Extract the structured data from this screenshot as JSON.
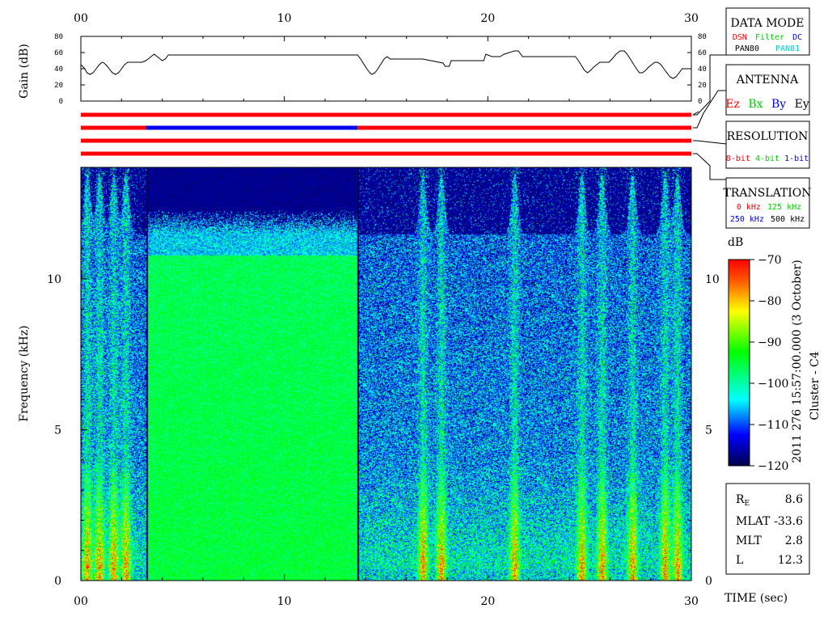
{
  "chart_data": [
    {
      "type": "line",
      "name": "gain",
      "ylabel": "Gain (dB)",
      "xlim": [
        0,
        30
      ],
      "ylim": [
        0,
        80
      ],
      "x_ticks": [
        "00",
        "10",
        "20",
        "30"
      ],
      "y_ticks": [
        "0",
        "20",
        "40",
        "60",
        "80"
      ],
      "series": [
        {
          "x": [
            0,
            0.2,
            0.3,
            0.45,
            0.6,
            0.75,
            0.9,
            1.05,
            1.15,
            1.3,
            1.45,
            1.55,
            1.7,
            1.85,
            2.0,
            2.15,
            2.3,
            2.45,
            2.55,
            2.7,
            3.0,
            3.2,
            3.3,
            3.45,
            3.6,
            3.75,
            3.9,
            4.0,
            4.15,
            4.3,
            13.6,
            13.75,
            13.9,
            14.05,
            14.2,
            14.3,
            14.45,
            14.6,
            14.75,
            14.9,
            15.05,
            15.2,
            16.8,
            17.8,
            17.9,
            18.1,
            18.2,
            19.8,
            19.9,
            20.2,
            20.6,
            20.8,
            21.3,
            21.5,
            21.7,
            24.3,
            24.45,
            24.6,
            24.75,
            24.9,
            25.05,
            25.2,
            25.35,
            25.5,
            25.65,
            25.8,
            25.95,
            26.1,
            26.3,
            26.5,
            26.7,
            26.85,
            27.0,
            27.15,
            27.3,
            27.45,
            27.6,
            27.75,
            27.9,
            28.05,
            28.2,
            28.35,
            28.5,
            28.65,
            28.8,
            28.95,
            29.1,
            29.25,
            29.4,
            29.55,
            29.7,
            29.85,
            30.0
          ],
          "y": [
            45,
            40,
            35,
            33,
            35,
            40,
            45,
            48,
            47,
            43,
            38,
            35,
            33,
            35,
            40,
            45,
            48,
            48,
            48,
            48,
            48,
            50,
            52,
            55,
            58,
            55,
            52,
            50,
            52,
            57,
            57,
            52,
            46,
            40,
            35,
            33,
            35,
            40,
            46,
            52,
            55,
            52,
            52,
            47,
            43,
            43,
            50,
            50,
            58,
            55,
            55,
            58,
            62,
            62,
            55,
            55,
            50,
            44,
            38,
            35,
            38,
            42,
            45,
            48,
            48,
            48,
            48,
            52,
            58,
            62,
            62,
            58,
            52,
            46,
            40,
            35,
            35,
            38,
            42,
            45,
            48,
            48,
            45,
            40,
            35,
            30,
            28,
            30,
            35,
            40,
            40,
            40,
            40
          ]
        }
      ]
    },
    {
      "type": "table",
      "name": "mode-bars",
      "rows": [
        {
          "segments": [
            [
              0,
              30,
              "#ff0000"
            ]
          ]
        },
        {
          "segments": [
            [
              0,
              3.2,
              "#ff0000"
            ],
            [
              3.2,
              13.6,
              "#0000ee"
            ],
            [
              13.6,
              30,
              "#ff0000"
            ]
          ]
        },
        {
          "segments": [
            [
              0,
              30,
              "#ff0000"
            ]
          ]
        },
        {
          "segments": [
            [
              0,
              30,
              "#ff0000"
            ]
          ]
        }
      ]
    },
    {
      "type": "heatmap",
      "name": "spectrogram",
      "title": "",
      "xlabel": "TIME (sec)",
      "ylabel": "Frequency (kHz)",
      "xlim": [
        0,
        30
      ],
      "ylim": [
        0,
        13.7
      ],
      "x_ticks": [
        "00",
        "10",
        "20",
        "30"
      ],
      "y_ticks": [
        "0",
        "5",
        "10"
      ],
      "colorbar": {
        "label": "dB",
        "range": [
          -120,
          -70
        ],
        "ticks": [
          "-70",
          "-80",
          "-90",
          "-100",
          "-110",
          "-120"
        ]
      },
      "regions": [
        {
          "x": [
            0,
            3.2
          ],
          "state": "normal"
        },
        {
          "x": [
            3.2,
            13.6
          ],
          "state": "filtered"
        },
        {
          "x": [
            13.6,
            30
          ],
          "state": "normal"
        }
      ],
      "bursts_at_x": [
        0.3,
        0.9,
        1.6,
        2.2,
        16.8,
        17.7,
        21.3,
        24.6,
        25.6,
        27.1,
        28.7,
        29.3
      ],
      "colors": [
        "#00004d",
        "#0000ff",
        "#00ffff",
        "#00ff00",
        "#ffff00",
        "#ff0000"
      ]
    }
  ],
  "legend": {
    "data_mode": {
      "title": "DATA MODE",
      "row1": [
        {
          "text": "DSN",
          "color": "#ff0000"
        },
        {
          "text": "Filter",
          "color": "#00cc00"
        },
        {
          "text": "DC",
          "color": "#0000ff"
        }
      ],
      "row2": [
        {
          "text": "PAN80",
          "color": "#000000"
        },
        {
          "text": "PAN81",
          "color": "#00cccc"
        }
      ]
    },
    "antenna": {
      "title": "ANTENNA",
      "row1": [
        {
          "text": "Ez",
          "color": "#ff0000"
        },
        {
          "text": "Bx",
          "color": "#00cc00"
        },
        {
          "text": "By",
          "color": "#0000ff"
        },
        {
          "text": "Ey",
          "color": "#000000"
        }
      ]
    },
    "resolution": {
      "title": "RESOLUTION",
      "row1": [
        {
          "text": "8-bit",
          "color": "#ff0000"
        },
        {
          "text": "4-bit",
          "color": "#00cc00"
        },
        {
          "text": "1-bit",
          "color": "#0000ff"
        }
      ]
    },
    "translation": {
      "title": "TRANSLATION",
      "row1": [
        {
          "text": "0 kHz",
          "color": "#ff0000"
        },
        {
          "text": "125 kHz",
          "color": "#00cc00"
        }
      ],
      "row2": [
        {
          "text": "250 kHz",
          "color": "#0000ff"
        },
        {
          "text": "500 kHz",
          "color": "#000000"
        }
      ]
    }
  },
  "side_label": "2011 276 15:57:00.000 (3 October)",
  "mission_label": "Cluster - C4",
  "orbit": {
    "rows": [
      {
        "label": "R",
        "sub": "E",
        "value": "8.6"
      },
      {
        "label": "MLAT",
        "value": "-33.6"
      },
      {
        "label": "MLT",
        "value": "2.8"
      },
      {
        "label": "L",
        "value": "12.3"
      }
    ]
  }
}
